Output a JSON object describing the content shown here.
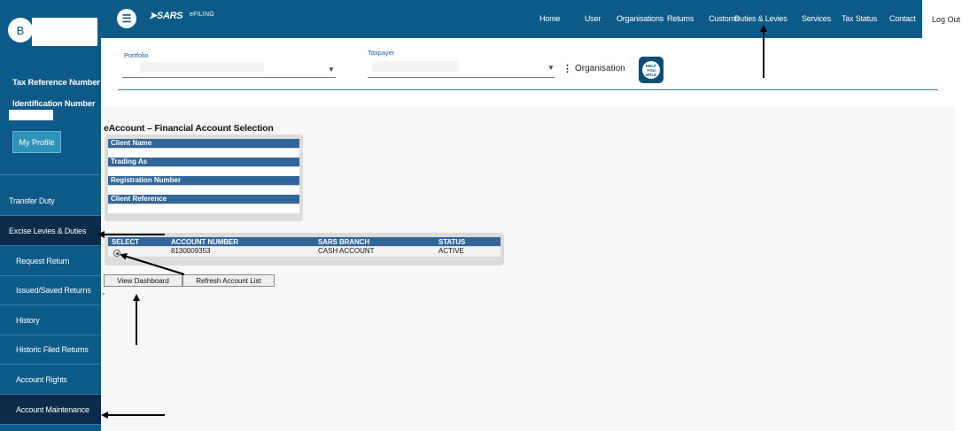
{
  "sidebar": {
    "avatar_initial": "B",
    "tax_reference_label": "Tax Reference Number",
    "identification_label": "Identification Number",
    "my_profile_label": "My Profile",
    "menu": [
      {
        "label": "Transfer Duty"
      },
      {
        "label": "Excise Levies & Duties"
      },
      {
        "label": "Request Return"
      },
      {
        "label": "Issued/Saved Returns"
      },
      {
        "label": "History"
      },
      {
        "label": "Historic Filed Returns"
      },
      {
        "label": "Account Rights"
      },
      {
        "label": "Account Maintenance"
      }
    ]
  },
  "topbar": {
    "menu_icon": "hamburger-icon",
    "logo_text": "SARS",
    "efiling_text": "eFILING",
    "nav": [
      {
        "label": "Home"
      },
      {
        "label": "User"
      },
      {
        "label": "Organisations"
      },
      {
        "label": "Returns"
      },
      {
        "label": "Customs"
      },
      {
        "label": "Duties & Levies"
      },
      {
        "label": "Services"
      },
      {
        "label": "Tax Status"
      },
      {
        "label": "Contact"
      }
    ],
    "logout_label": "Log Out"
  },
  "filter": {
    "portfolio_label": "Portfolio",
    "taxpayer_label": "Taxpayer",
    "organisation_label": "Organisation",
    "help_icon_text": "HELP YOU eFILE"
  },
  "content": {
    "title": "eAccount – Financial Account Selection",
    "client": {
      "client_name_label": "Client Name",
      "trading_as_label": "Trading As",
      "registration_number_label": "Registration Number",
      "client_reference_label": "Client Reference"
    },
    "accounts": {
      "headers": [
        "SELECT",
        "ACCOUNT NUMBER",
        "SARS BRANCH",
        "STATUS"
      ],
      "rows": [
        {
          "account_number": "8130009353",
          "branch": "CASH ACCOUNT",
          "status": "ACTIVE"
        }
      ]
    },
    "view_dashboard_label": "View Dashboard",
    "refresh_list_label": "Refresh Account List"
  },
  "colors": {
    "brand_blue": "#0d5a88",
    "sidebar_highlight": "#0a2b4a",
    "table_header": "#336698",
    "profile_button": "#2d94b8"
  }
}
